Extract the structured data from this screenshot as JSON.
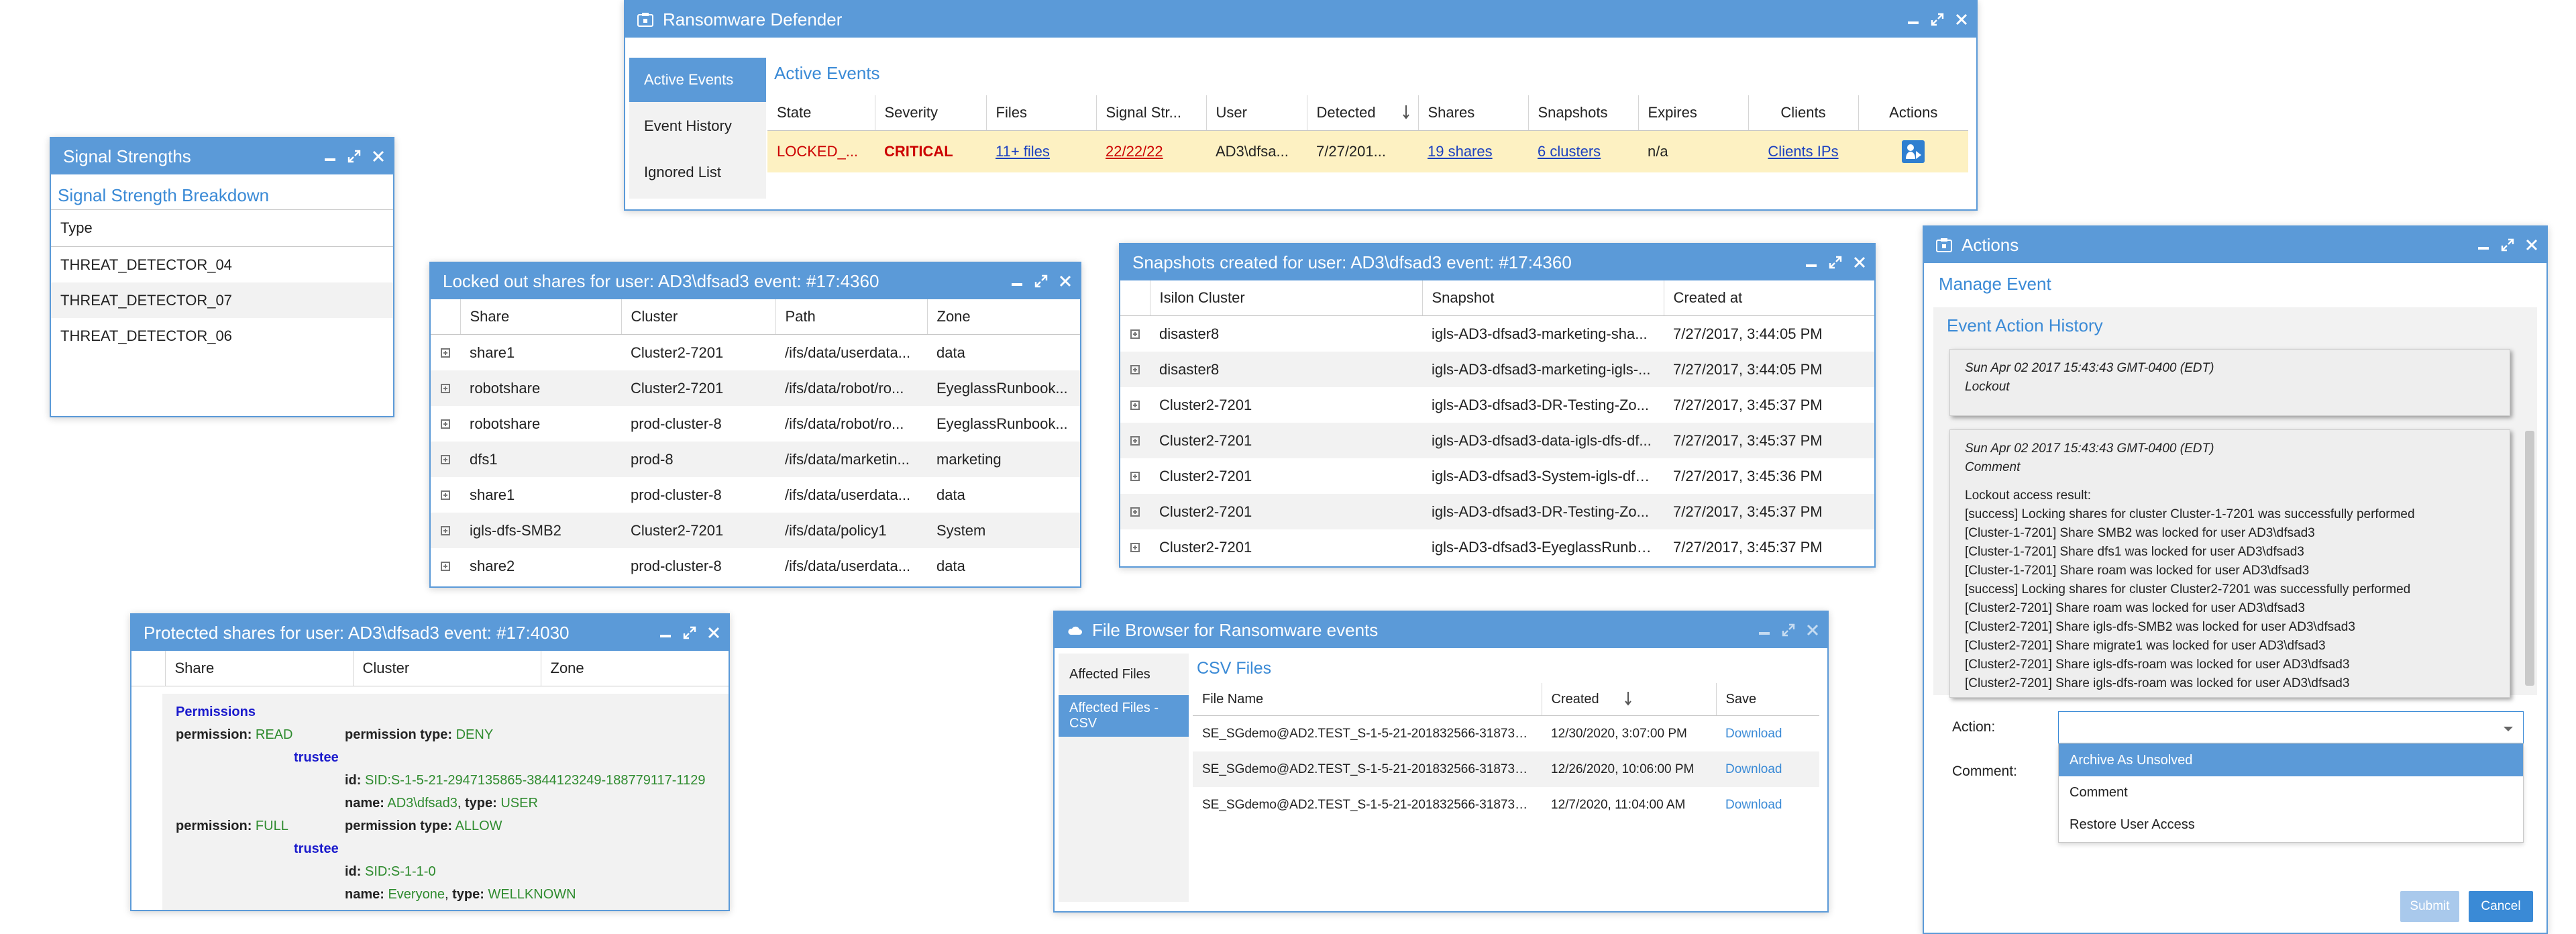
{
  "defender": {
    "title": "Ransomware Defender",
    "nav": [
      "Active Events",
      "Event History",
      "Ignored List"
    ],
    "section_title": "Active Events",
    "columns": [
      "State",
      "Severity",
      "Files",
      "Signal Str...",
      "User",
      "Detected",
      "Shares",
      "Snapshots",
      "Expires",
      "Clients",
      "Actions"
    ],
    "row": {
      "state": "LOCKED_...",
      "severity": "CRITICAL",
      "files": "11+ files",
      "signal": "22/22/22",
      "user": "AD3\\dfsa...",
      "detected": "7/27/201...",
      "shares": "19 shares",
      "snapshots": "6 clusters",
      "expires": "n/a",
      "clients": "Clients IPs"
    }
  },
  "signal": {
    "title": "Signal Strengths",
    "section_title": "Signal Strength Breakdown",
    "column": "Type",
    "rows": [
      "THREAT_DETECTOR_04",
      "THREAT_DETECTOR_07",
      "THREAT_DETECTOR_06"
    ]
  },
  "locked": {
    "title": "Locked out shares for user: AD3\\dfsad3 event: #17:4360",
    "columns": [
      "Share",
      "Cluster",
      "Path",
      "Zone"
    ],
    "rows": [
      [
        "share1",
        "Cluster2-7201",
        "/ifs/data/userdata...",
        "data"
      ],
      [
        "robotshare",
        "Cluster2-7201",
        "/ifs/data/robot/ro...",
        "EyeglassRunbook..."
      ],
      [
        "robotshare",
        "prod-cluster-8",
        "/ifs/data/robot/ro...",
        "EyeglassRunbook..."
      ],
      [
        "dfs1",
        "prod-8",
        "/ifs/data/marketin...",
        "marketing"
      ],
      [
        "share1",
        "prod-cluster-8",
        "/ifs/data/userdata...",
        "data"
      ],
      [
        "igls-dfs-SMB2",
        "Cluster2-7201",
        "/ifs/data/policy1",
        "System"
      ],
      [
        "share2",
        "prod-cluster-8",
        "/ifs/data/userdata...",
        "data"
      ]
    ]
  },
  "snapshots": {
    "title": "Snapshots created for user: AD3\\dfsad3 event: #17:4360",
    "columns": [
      "Isilon Cluster",
      "Snapshot",
      "Created at"
    ],
    "rows": [
      [
        "disaster8",
        "igls-AD3-dfsad3-marketing-sha...",
        "7/27/2017, 3:44:05 PM"
      ],
      [
        "disaster8",
        "igls-AD3-dfsad3-marketing-igls-...",
        "7/27/2017, 3:44:05 PM"
      ],
      [
        "Cluster2-7201",
        "igls-AD3-dfsad3-DR-Testing-Zo...",
        "7/27/2017, 3:45:37 PM"
      ],
      [
        "Cluster2-7201",
        "igls-AD3-dfsad3-data-igls-dfs-df...",
        "7/27/2017, 3:45:37 PM"
      ],
      [
        "Cluster2-7201",
        "igls-AD3-dfsad3-System-igls-dfs...",
        "7/27/2017, 3:45:36 PM"
      ],
      [
        "Cluster2-7201",
        "igls-AD3-dfsad3-DR-Testing-Zo...",
        "7/27/2017, 3:45:37 PM"
      ],
      [
        "Cluster2-7201",
        "igls-AD3-dfsad3-EyeglassRunbo...",
        "7/27/2017, 3:45:37 PM"
      ]
    ]
  },
  "protected": {
    "title": "Protected shares for user: AD3\\dfsad3 event: #17:4030",
    "columns": [
      "Share",
      "Cluster",
      "Zone"
    ],
    "permissions_label": "Permissions",
    "perm1": {
      "permission_key": "permission:",
      "permission_val": "READ",
      "type_key": "permission type:",
      "type_val": "DENY",
      "trustee": "trustee",
      "id_key": "id:",
      "id_val": "SID:S-1-5-21-2947135865-3844123249-188779117-1129",
      "name_key": "name:",
      "name_val": "AD3\\dfsad3",
      "ntype_key": "type:",
      "ntype_val": "USER"
    },
    "perm2": {
      "permission_key": "permission:",
      "permission_val": "FULL",
      "type_key": "permission type:",
      "type_val": "ALLOW",
      "trustee": "trustee",
      "id_key": "id:",
      "id_val": "SID:S-1-1-0",
      "name_key": "name:",
      "name_val": "Everyone",
      "ntype_key": "type:",
      "ntype_val": "WELLKNOWN"
    }
  },
  "browser": {
    "title": "File Browser for Ransomware events",
    "nav": [
      "Affected Files",
      "Affected Files - CSV"
    ],
    "section_title": "CSV Files",
    "columns": [
      "File Name",
      "Created",
      "Save"
    ],
    "rows": [
      [
        "SE_SGdemo@AD2.TEST_S-1-5-21-201832566-31873534...",
        "12/30/2020, 3:07:00 PM",
        "Download"
      ],
      [
        "SE_SGdemo@AD2.TEST_S-1-5-21-201832566-31873534...",
        "12/26/2020, 10:06:00 PM",
        "Download"
      ],
      [
        "SE_SGdemo@AD2.TEST_S-1-5-21-201832566-31873534...",
        "12/7/2020, 11:04:00 AM",
        "Download"
      ]
    ]
  },
  "actions": {
    "title": "Actions",
    "manage_title": "Manage Event",
    "history_title": "Event Action History",
    "entries": [
      {
        "date": "Sun Apr 02 2017 15:43:43 GMT-0400 (EDT)",
        "kind": "Lockout"
      },
      {
        "date": "Sun Apr 02 2017 15:43:43 GMT-0400 (EDT)",
        "kind": "Comment"
      }
    ],
    "log_header": "Lockout access result:",
    "log": [
      "[success] Locking shares for cluster Cluster-1-7201 was successfully performed",
      "[Cluster-1-7201] Share SMB2 was locked for user AD3\\dfsad3",
      "[Cluster-1-7201] Share dfs1 was locked for user AD3\\dfsad3",
      "[Cluster-1-7201] Share roam was locked for user AD3\\dfsad3",
      "[success] Locking shares for cluster Cluster2-7201 was successfully performed",
      "[Cluster2-7201] Share roam was locked for user AD3\\dfsad3",
      "[Cluster2-7201] Share igls-dfs-SMB2 was locked for user AD3\\dfsad3",
      "[Cluster2-7201] Share migrate1 was locked for user AD3\\dfsad3",
      "[Cluster2-7201] Share igls-dfs-roam was locked for user AD3\\dfsad3",
      "[Cluster2-7201] Share igls-dfs-roam was locked for user AD3\\dfsad3"
    ],
    "action_label": "Action:",
    "comment_label": "Comment:",
    "options": [
      "Archive As Unsolved",
      "Comment",
      "Restore User Access"
    ],
    "submit": "Submit",
    "cancel": "Cancel"
  },
  "colors": {
    "accent": "#5b9ad8",
    "critical": "#cc0000",
    "link": "#1a3fc0",
    "green": "#2e8b2e",
    "highlight_row": "#fdf1c2"
  }
}
